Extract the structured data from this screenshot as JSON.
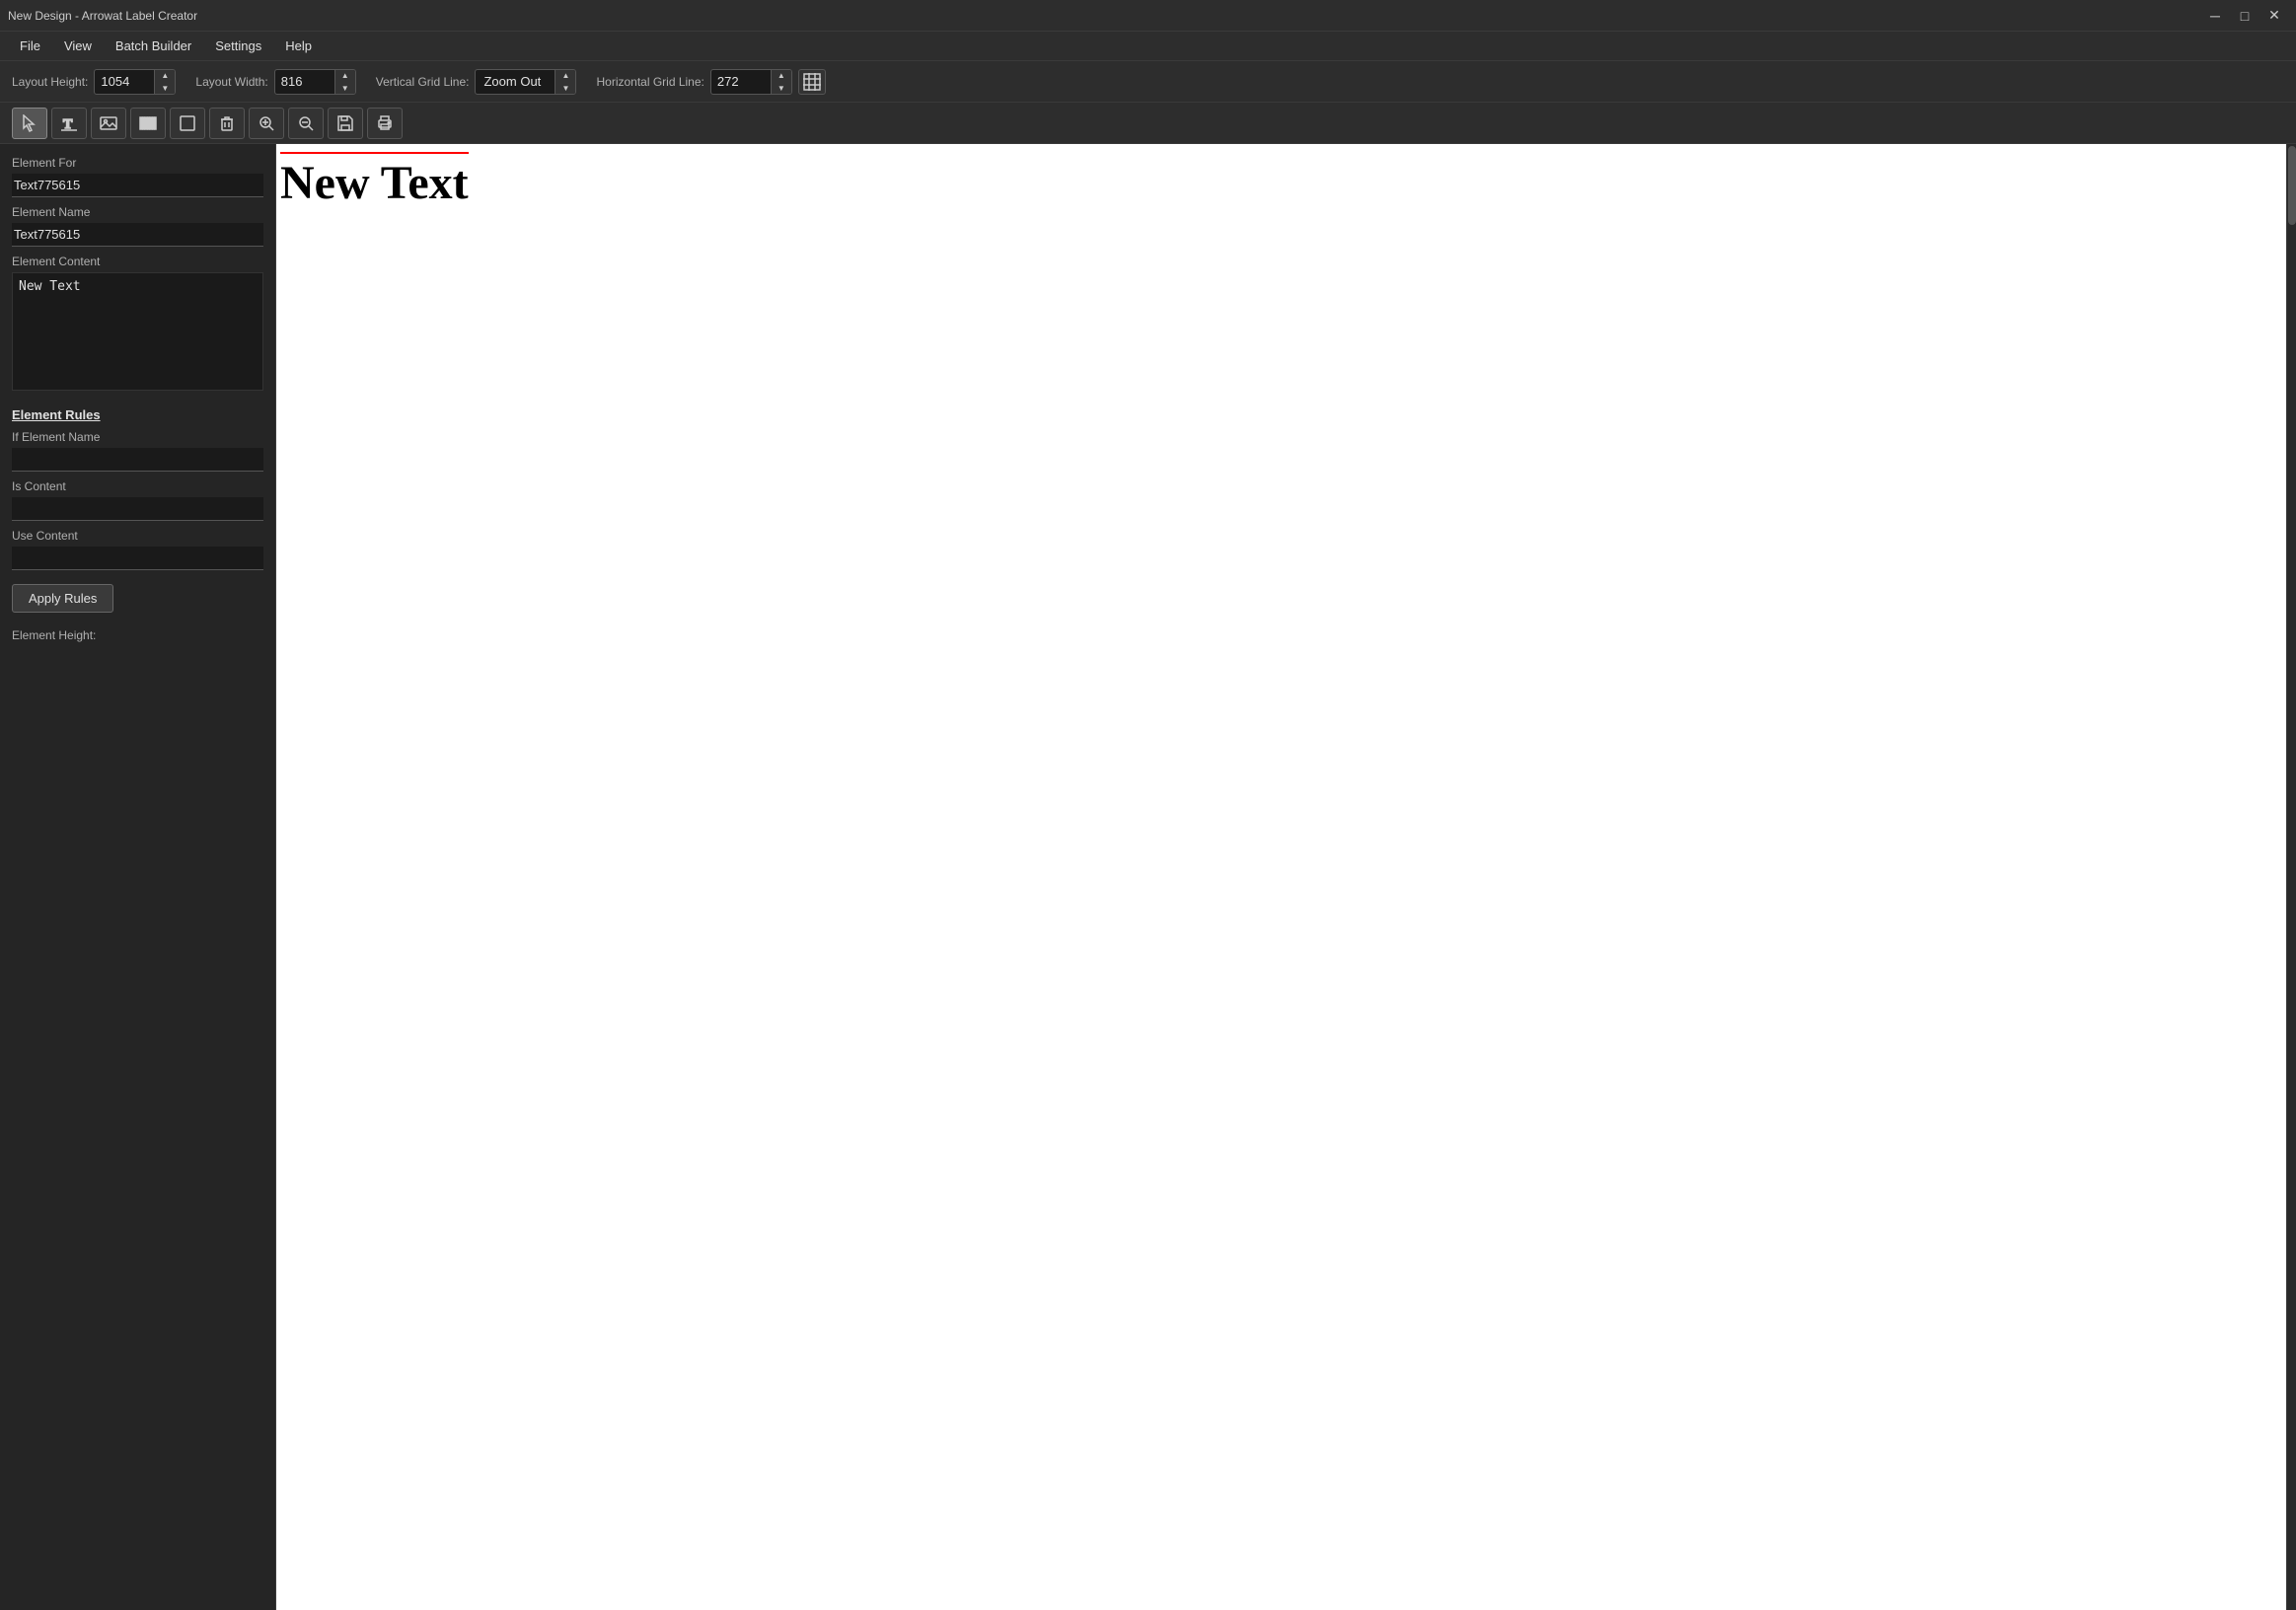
{
  "titleBar": {
    "title": "New Design - Arrowat Label Creator",
    "minBtn": "─",
    "maxBtn": "□",
    "closeBtn": "✕"
  },
  "menuBar": {
    "items": [
      "File",
      "View",
      "Batch Builder",
      "Settings",
      "Help"
    ]
  },
  "layoutToolbar": {
    "layoutHeightLabel": "Layout Height:",
    "layoutHeightValue": "1054",
    "layoutWidthLabel": "Layout Width:",
    "layoutWidthValue": "816",
    "verticalGridLineLabel": "Vertical Grid Line:",
    "verticalGridLineValue": "Zoom Out",
    "horizontalGridLineLabel": "Horizontal Grid Line:",
    "horizontalGridLineValue": "272"
  },
  "sidebar": {
    "elementForLabel": "Element For",
    "elementForValue": "Text775615",
    "elementNameLabel": "Element Name",
    "elementNameValue": "Text775615",
    "elementContentLabel": "Element Content",
    "elementContentValue": "New Text",
    "elementRulesLabel": "Element Rules",
    "ifElementNameLabel": "If Element Name",
    "ifElementNameValue": "",
    "isContentLabel": "Is Content",
    "isContentValue": "",
    "useContentLabel": "Use Content",
    "useContentValue": "",
    "applyRulesLabel": "Apply Rules",
    "elementHeightLabel": "Element Height:"
  },
  "canvas": {
    "text": "New Text"
  },
  "tools": [
    {
      "name": "select",
      "icon": "cursor",
      "unicode": "↖"
    },
    {
      "name": "text",
      "icon": "text-cursor",
      "unicode": "T"
    },
    {
      "name": "image",
      "icon": "image",
      "unicode": "⬜"
    },
    {
      "name": "barcode",
      "icon": "barcode",
      "unicode": "▤"
    },
    {
      "name": "shape",
      "icon": "shape",
      "unicode": "⬛"
    },
    {
      "name": "delete",
      "icon": "trash",
      "unicode": "🗑"
    },
    {
      "name": "zoom-in",
      "icon": "zoom-in",
      "unicode": "⊕"
    },
    {
      "name": "zoom-out",
      "icon": "zoom-out",
      "unicode": "⊖"
    },
    {
      "name": "save",
      "icon": "save",
      "unicode": "💾"
    },
    {
      "name": "print",
      "icon": "print",
      "unicode": "🖨"
    }
  ]
}
